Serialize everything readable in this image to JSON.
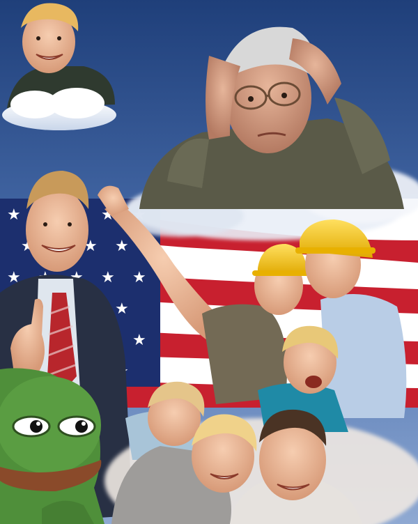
{
  "image": {
    "kind": "photo-collage",
    "subjects": [
      "smiling-man-on-cloud",
      "worried-old-man-holding-head",
      "american-flag",
      "businessman-thumbs-up",
      "construction-workers-hard-hats",
      "smiling-family",
      "pepe-frog-cartoon"
    ],
    "colors": {
      "sky_top": "#1f3f7a",
      "sky_bottom": "#6d8fc4",
      "flag_red": "#c8202f",
      "flag_blue": "#1c2f6e",
      "hard_hat": "#f2c21a",
      "frog_green": "#4f8f3a"
    }
  }
}
